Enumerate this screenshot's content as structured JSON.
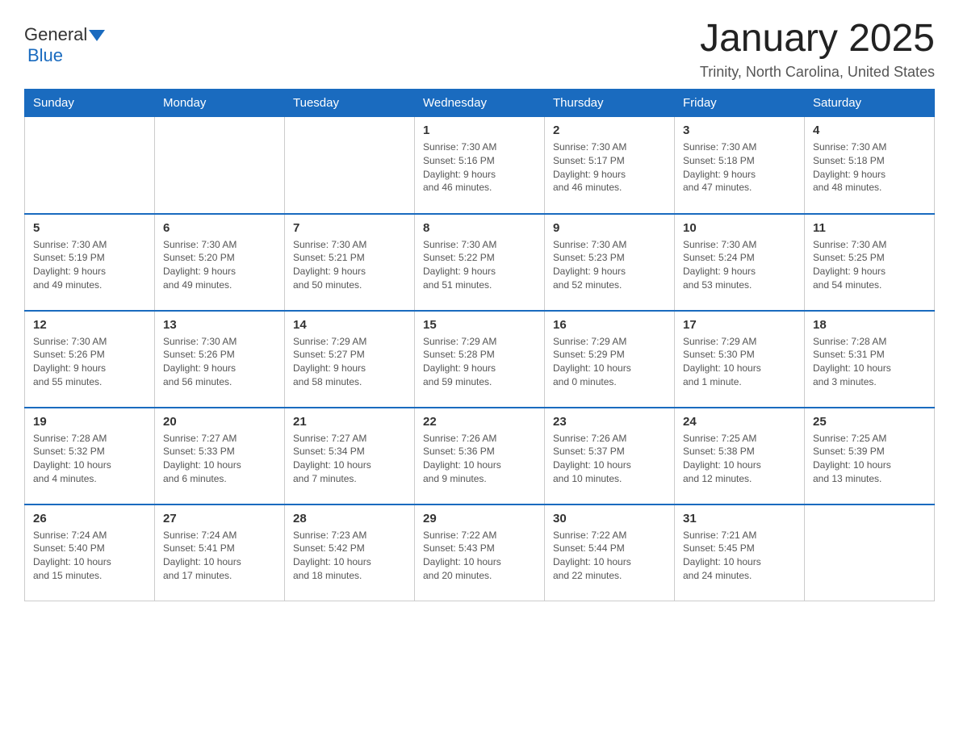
{
  "logo": {
    "text_general": "General",
    "text_blue": "Blue"
  },
  "header": {
    "title": "January 2025",
    "subtitle": "Trinity, North Carolina, United States"
  },
  "days_of_week": [
    "Sunday",
    "Monday",
    "Tuesday",
    "Wednesday",
    "Thursday",
    "Friday",
    "Saturday"
  ],
  "weeks": [
    [
      {
        "day": "",
        "info": ""
      },
      {
        "day": "",
        "info": ""
      },
      {
        "day": "",
        "info": ""
      },
      {
        "day": "1",
        "info": "Sunrise: 7:30 AM\nSunset: 5:16 PM\nDaylight: 9 hours\nand 46 minutes."
      },
      {
        "day": "2",
        "info": "Sunrise: 7:30 AM\nSunset: 5:17 PM\nDaylight: 9 hours\nand 46 minutes."
      },
      {
        "day": "3",
        "info": "Sunrise: 7:30 AM\nSunset: 5:18 PM\nDaylight: 9 hours\nand 47 minutes."
      },
      {
        "day": "4",
        "info": "Sunrise: 7:30 AM\nSunset: 5:18 PM\nDaylight: 9 hours\nand 48 minutes."
      }
    ],
    [
      {
        "day": "5",
        "info": "Sunrise: 7:30 AM\nSunset: 5:19 PM\nDaylight: 9 hours\nand 49 minutes."
      },
      {
        "day": "6",
        "info": "Sunrise: 7:30 AM\nSunset: 5:20 PM\nDaylight: 9 hours\nand 49 minutes."
      },
      {
        "day": "7",
        "info": "Sunrise: 7:30 AM\nSunset: 5:21 PM\nDaylight: 9 hours\nand 50 minutes."
      },
      {
        "day": "8",
        "info": "Sunrise: 7:30 AM\nSunset: 5:22 PM\nDaylight: 9 hours\nand 51 minutes."
      },
      {
        "day": "9",
        "info": "Sunrise: 7:30 AM\nSunset: 5:23 PM\nDaylight: 9 hours\nand 52 minutes."
      },
      {
        "day": "10",
        "info": "Sunrise: 7:30 AM\nSunset: 5:24 PM\nDaylight: 9 hours\nand 53 minutes."
      },
      {
        "day": "11",
        "info": "Sunrise: 7:30 AM\nSunset: 5:25 PM\nDaylight: 9 hours\nand 54 minutes."
      }
    ],
    [
      {
        "day": "12",
        "info": "Sunrise: 7:30 AM\nSunset: 5:26 PM\nDaylight: 9 hours\nand 55 minutes."
      },
      {
        "day": "13",
        "info": "Sunrise: 7:30 AM\nSunset: 5:26 PM\nDaylight: 9 hours\nand 56 minutes."
      },
      {
        "day": "14",
        "info": "Sunrise: 7:29 AM\nSunset: 5:27 PM\nDaylight: 9 hours\nand 58 minutes."
      },
      {
        "day": "15",
        "info": "Sunrise: 7:29 AM\nSunset: 5:28 PM\nDaylight: 9 hours\nand 59 minutes."
      },
      {
        "day": "16",
        "info": "Sunrise: 7:29 AM\nSunset: 5:29 PM\nDaylight: 10 hours\nand 0 minutes."
      },
      {
        "day": "17",
        "info": "Sunrise: 7:29 AM\nSunset: 5:30 PM\nDaylight: 10 hours\nand 1 minute."
      },
      {
        "day": "18",
        "info": "Sunrise: 7:28 AM\nSunset: 5:31 PM\nDaylight: 10 hours\nand 3 minutes."
      }
    ],
    [
      {
        "day": "19",
        "info": "Sunrise: 7:28 AM\nSunset: 5:32 PM\nDaylight: 10 hours\nand 4 minutes."
      },
      {
        "day": "20",
        "info": "Sunrise: 7:27 AM\nSunset: 5:33 PM\nDaylight: 10 hours\nand 6 minutes."
      },
      {
        "day": "21",
        "info": "Sunrise: 7:27 AM\nSunset: 5:34 PM\nDaylight: 10 hours\nand 7 minutes."
      },
      {
        "day": "22",
        "info": "Sunrise: 7:26 AM\nSunset: 5:36 PM\nDaylight: 10 hours\nand 9 minutes."
      },
      {
        "day": "23",
        "info": "Sunrise: 7:26 AM\nSunset: 5:37 PM\nDaylight: 10 hours\nand 10 minutes."
      },
      {
        "day": "24",
        "info": "Sunrise: 7:25 AM\nSunset: 5:38 PM\nDaylight: 10 hours\nand 12 minutes."
      },
      {
        "day": "25",
        "info": "Sunrise: 7:25 AM\nSunset: 5:39 PM\nDaylight: 10 hours\nand 13 minutes."
      }
    ],
    [
      {
        "day": "26",
        "info": "Sunrise: 7:24 AM\nSunset: 5:40 PM\nDaylight: 10 hours\nand 15 minutes."
      },
      {
        "day": "27",
        "info": "Sunrise: 7:24 AM\nSunset: 5:41 PM\nDaylight: 10 hours\nand 17 minutes."
      },
      {
        "day": "28",
        "info": "Sunrise: 7:23 AM\nSunset: 5:42 PM\nDaylight: 10 hours\nand 18 minutes."
      },
      {
        "day": "29",
        "info": "Sunrise: 7:22 AM\nSunset: 5:43 PM\nDaylight: 10 hours\nand 20 minutes."
      },
      {
        "day": "30",
        "info": "Sunrise: 7:22 AM\nSunset: 5:44 PM\nDaylight: 10 hours\nand 22 minutes."
      },
      {
        "day": "31",
        "info": "Sunrise: 7:21 AM\nSunset: 5:45 PM\nDaylight: 10 hours\nand 24 minutes."
      },
      {
        "day": "",
        "info": ""
      }
    ]
  ]
}
